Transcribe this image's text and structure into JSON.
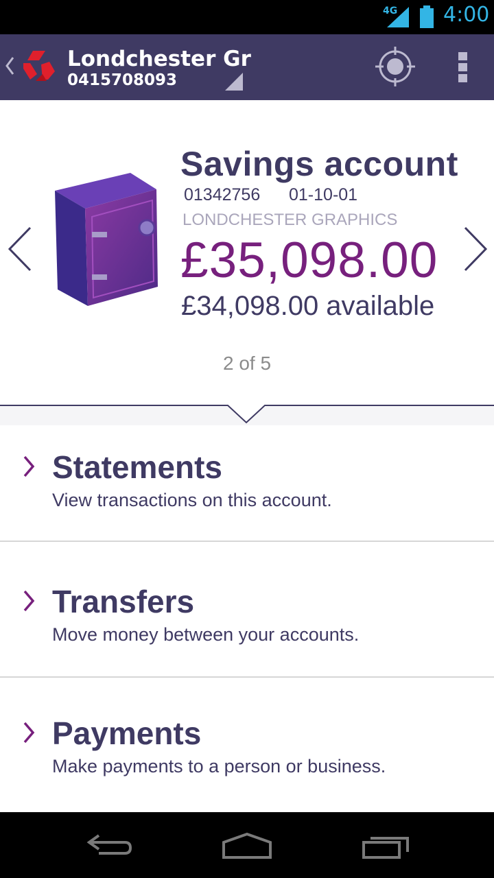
{
  "status_bar": {
    "network": "4G",
    "time": "4:00"
  },
  "app_bar": {
    "title": "Londchester Gr",
    "subtitle": "0415708093"
  },
  "account": {
    "title": "Savings account",
    "number": "01342756",
    "sort_code": "01-10-01",
    "owner": "LONDCHESTER GRAPHICS",
    "balance": "£35,098.00",
    "available": "£34,098.00 available",
    "pager": "2 of 5"
  },
  "menu": {
    "items": [
      {
        "label": "Statements",
        "description": "View transactions on this account."
      },
      {
        "label": "Transfers",
        "description": "Move money between your accounts."
      },
      {
        "label": "Payments",
        "description": "Make payments to a person or business."
      }
    ]
  },
  "colors": {
    "brand": "#3f3a63",
    "accent": "#77207d",
    "status": "#33b5e5",
    "logo": "#e0202c"
  },
  "icons": [
    "signal-icon",
    "battery-icon",
    "back-caret-icon",
    "bank-logo-icon",
    "spinner-indicator-icon",
    "locate-icon",
    "overflow-menu-icon",
    "chevron-left-icon",
    "chevron-right-icon",
    "safe-icon",
    "chevron-right-small-icon",
    "back-nav-icon",
    "home-nav-icon",
    "recents-nav-icon"
  ]
}
